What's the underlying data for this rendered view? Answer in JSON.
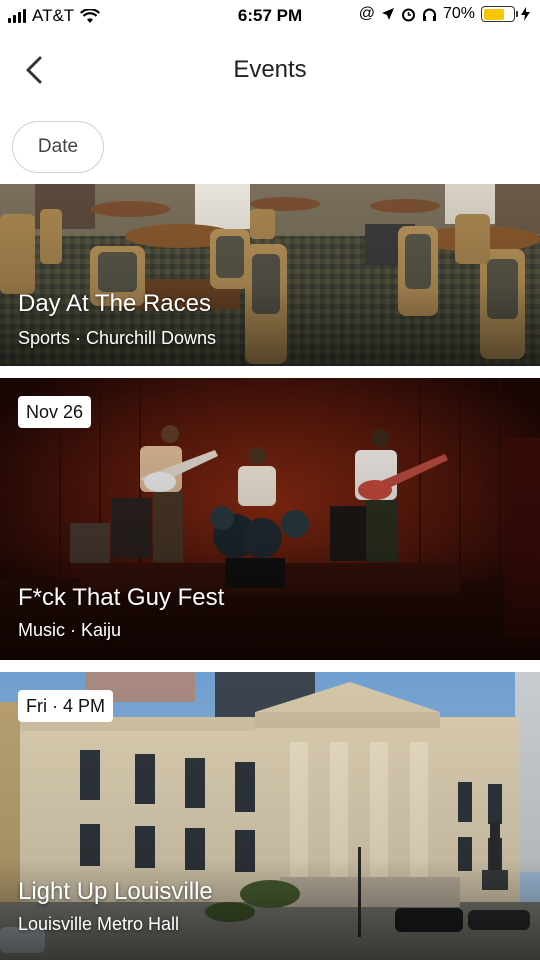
{
  "status_bar": {
    "carrier": "AT&T",
    "time": "6:57 PM",
    "battery_percent": "70%",
    "battery_level": 0.7,
    "icons": [
      "signal-icon",
      "wifi-icon",
      "at-icon",
      "location-icon",
      "alarm-icon",
      "headphones-icon",
      "battery-icon",
      "charging-icon"
    ]
  },
  "header": {
    "title": "Events"
  },
  "filters": {
    "date_label": "Date"
  },
  "events": [
    {
      "title": "Day At The Races",
      "subtitle": "Sports · Churchill Downs",
      "date": ""
    },
    {
      "title": "F*ck That Guy Fest",
      "subtitle": "Music · Kaiju",
      "date": "Nov 26"
    },
    {
      "title": "Light Up Louisville",
      "subtitle": "Louisville Metro Hall",
      "date": "Fri · 4 PM"
    }
  ],
  "colors": {
    "battery": "#f7c600",
    "text_primary": "#222222",
    "card_text": "#ffffff"
  }
}
